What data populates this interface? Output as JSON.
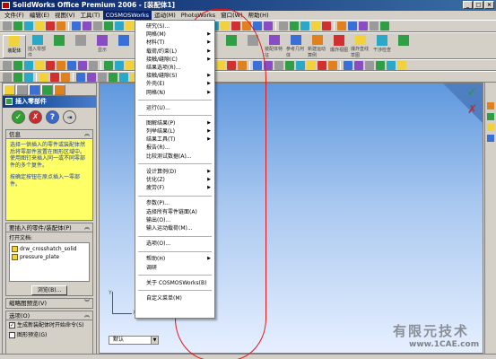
{
  "titlebar": {
    "title": "SolidWorks Office Premium 2006 - [装配体1]",
    "win_buttons": [
      "_",
      "□",
      "×"
    ]
  },
  "menubar": {
    "items": [
      {
        "label": "文件(F)"
      },
      {
        "label": "编辑(E)"
      },
      {
        "label": "视图(V)"
      },
      {
        "label": "工具(T)"
      },
      {
        "label": "COSMOSWorks"
      },
      {
        "label": "运动(M)"
      },
      {
        "label": "PhotoWorks"
      },
      {
        "label": "窗口(W)"
      },
      {
        "label": "帮助(H)"
      }
    ]
  },
  "toolbar2": {
    "buttons": [
      {
        "label": "装配体"
      },
      {
        "label": "插入零部件"
      },
      {
        "label": ""
      },
      {
        "label": ""
      },
      {
        "label": "显示"
      },
      {
        "label": ""
      },
      {
        "label": ""
      },
      {
        "label": ""
      },
      {
        "label": ""
      },
      {
        "label": ""
      },
      {
        "label": ""
      },
      {
        "label": ""
      },
      {
        "label": "装配体特征"
      },
      {
        "label": "参考几何体"
      },
      {
        "label": "新建运动算例"
      },
      {
        "label": "爆炸视图"
      },
      {
        "label": "爆炸直线草图"
      },
      {
        "label": "干涉检查"
      },
      {
        "label": ""
      }
    ]
  },
  "leftpanel": {
    "header": "插入零部件",
    "message_title": "信息",
    "message_para1": "选择一供插入的零件或装配体然后将零部件放置在图形区域中。使用图钉来插入同一或不同零部件的多个复件。",
    "message_para2": "按确定按钮在原点插入一零部件。",
    "parts_title": "要插入的零件/装配体(P)",
    "open_docs_label": "打开文档:",
    "parts": [
      "drw_crosshatch_solid",
      "pressure_plate"
    ],
    "browse_label": "浏览(B)...",
    "thumbnail_title": "缩略图预览(V)",
    "options_title": "选项(O)",
    "opt1": "生成新装配体时开始命令(S)",
    "opt2": "图形预览(G)"
  },
  "graphics": {
    "triad_y": "Y",
    "triad_x": "X",
    "config": "默认"
  },
  "dropdown": {
    "items": [
      {
        "label": "研究(S)...",
        "arrow": ""
      },
      {
        "label": "网格(M)",
        "arrow": "▶"
      },
      {
        "label": "材料(T)",
        "arrow": "▶"
      },
      {
        "label": "载荷/约束(L)",
        "arrow": "▶"
      },
      {
        "label": "接触/缝隙(C)",
        "arrow": "▶"
      },
      {
        "label": "结果选项(R)...",
        "arrow": ""
      },
      {
        "label": "接触/缝隙(S)",
        "arrow": "▶"
      },
      {
        "label": "外壳(E)",
        "arrow": "▶"
      },
      {
        "label": "网格(N)",
        "arrow": "▶"
      },
      {
        "sep": true
      },
      {
        "label": "运行(U)...",
        "arrow": ""
      },
      {
        "sep": true
      },
      {
        "label": "图解结果(P)",
        "arrow": "▶"
      },
      {
        "label": "列举结果(L)",
        "arrow": "▶"
      },
      {
        "label": "结果工具(T)",
        "arrow": "▶"
      },
      {
        "label": "报告(R)...",
        "arrow": ""
      },
      {
        "label": "比较测试数据(A)...",
        "arrow": ""
      },
      {
        "sep": true
      },
      {
        "label": "设计算例(D)",
        "arrow": "▶"
      },
      {
        "label": "优化(Z)",
        "arrow": "▶"
      },
      {
        "label": "疲劳(F)",
        "arrow": "▶"
      },
      {
        "sep": true
      },
      {
        "label": "参数(P)...",
        "arrow": ""
      },
      {
        "label": "选择所有零件链面(A)",
        "arrow": ""
      },
      {
        "label": "输出(O)...",
        "arrow": ""
      },
      {
        "label": "输入运动载荷(M)...",
        "arrow": ""
      },
      {
        "sep": true
      },
      {
        "label": "选项(O)...",
        "arrow": ""
      },
      {
        "sep": true
      },
      {
        "label": "帮助(H)",
        "arrow": "▶"
      },
      {
        "label": "调研",
        "arrow": ""
      },
      {
        "sep": true
      },
      {
        "label": "关于 COSMOSWorks(B)",
        "arrow": ""
      },
      {
        "sep": true
      },
      {
        "label": "自定义菜单(M)",
        "arrow": ""
      }
    ]
  },
  "watermark": {
    "cn": "有限元技术",
    "url": "www.1CAE.com"
  },
  "colors": {
    "accent": "#0a246a",
    "message_bg": "#ffff66",
    "annotation": "#e01818"
  }
}
